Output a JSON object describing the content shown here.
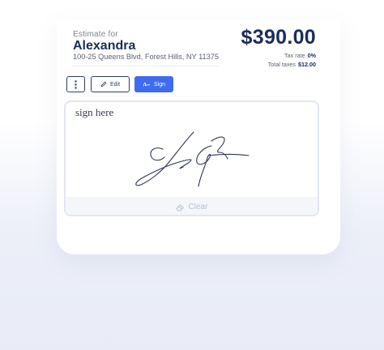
{
  "estimate": {
    "label": "Estimate for",
    "customer_name": "Alexandra",
    "address": "100-25 Queens Blvd, Forest Hills, NY 11375",
    "total": "$390.00",
    "tax_rate_label": "Tax rate",
    "tax_rate_value": "0%",
    "total_taxes_label": "Total taxes",
    "total_taxes_value": "$12.00"
  },
  "actions": {
    "edit_label": "Edit",
    "sign_label": "Sign",
    "more_icon": "more-vertical-icon",
    "edit_icon": "pencil-icon",
    "sign_icon": "signature-icon"
  },
  "signature_pad": {
    "prompt": "sign here",
    "clear_label": "Clear",
    "clear_icon": "eraser-icon"
  },
  "colors": {
    "primary": "#3d6cf0",
    "navy": "#1a2d5a",
    "ink": "#2c3550"
  }
}
